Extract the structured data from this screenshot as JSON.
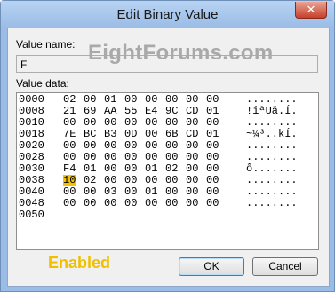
{
  "window": {
    "title": "Edit Binary Value",
    "close_glyph": "✕"
  },
  "watermark": "EightForums.com",
  "value_name": {
    "label": "Value name:",
    "value": "F"
  },
  "value_data": {
    "label": "Value data:",
    "rows": [
      {
        "offset": "0000",
        "bytes": [
          "02",
          "00",
          "01",
          "00",
          "00",
          "00",
          "00",
          "00"
        ],
        "ascii": "........"
      },
      {
        "offset": "0008",
        "bytes": [
          "21",
          "69",
          "AA",
          "55",
          "E4",
          "9C",
          "CD",
          "01"
        ],
        "ascii": "!iªUä.Í."
      },
      {
        "offset": "0010",
        "bytes": [
          "00",
          "00",
          "00",
          "00",
          "00",
          "00",
          "00",
          "00"
        ],
        "ascii": "........"
      },
      {
        "offset": "0018",
        "bytes": [
          "7E",
          "BC",
          "B3",
          "0D",
          "00",
          "6B",
          "CD",
          "01"
        ],
        "ascii": "~¼³..kÍ."
      },
      {
        "offset": "0020",
        "bytes": [
          "00",
          "00",
          "00",
          "00",
          "00",
          "00",
          "00",
          "00"
        ],
        "ascii": "........"
      },
      {
        "offset": "0028",
        "bytes": [
          "00",
          "00",
          "00",
          "00",
          "00",
          "00",
          "00",
          "00"
        ],
        "ascii": "........"
      },
      {
        "offset": "0030",
        "bytes": [
          "F4",
          "01",
          "00",
          "00",
          "01",
          "02",
          "00",
          "00"
        ],
        "ascii": "ô......."
      },
      {
        "offset": "0038",
        "bytes": [
          "10",
          "02",
          "00",
          "00",
          "00",
          "00",
          "00",
          "00"
        ],
        "ascii": "........"
      },
      {
        "offset": "0040",
        "bytes": [
          "00",
          "00",
          "03",
          "00",
          "01",
          "00",
          "00",
          "00"
        ],
        "ascii": "........"
      },
      {
        "offset": "0048",
        "bytes": [
          "00",
          "00",
          "00",
          "00",
          "00",
          "00",
          "00",
          "00"
        ],
        "ascii": "........"
      },
      {
        "offset": "0050",
        "bytes": [],
        "ascii": ""
      }
    ],
    "selected": {
      "row": 7,
      "byte": 0
    }
  },
  "annotation": {
    "text": "Enabled",
    "color": "#f0c000"
  },
  "buttons": {
    "ok": "OK",
    "cancel": "Cancel"
  }
}
